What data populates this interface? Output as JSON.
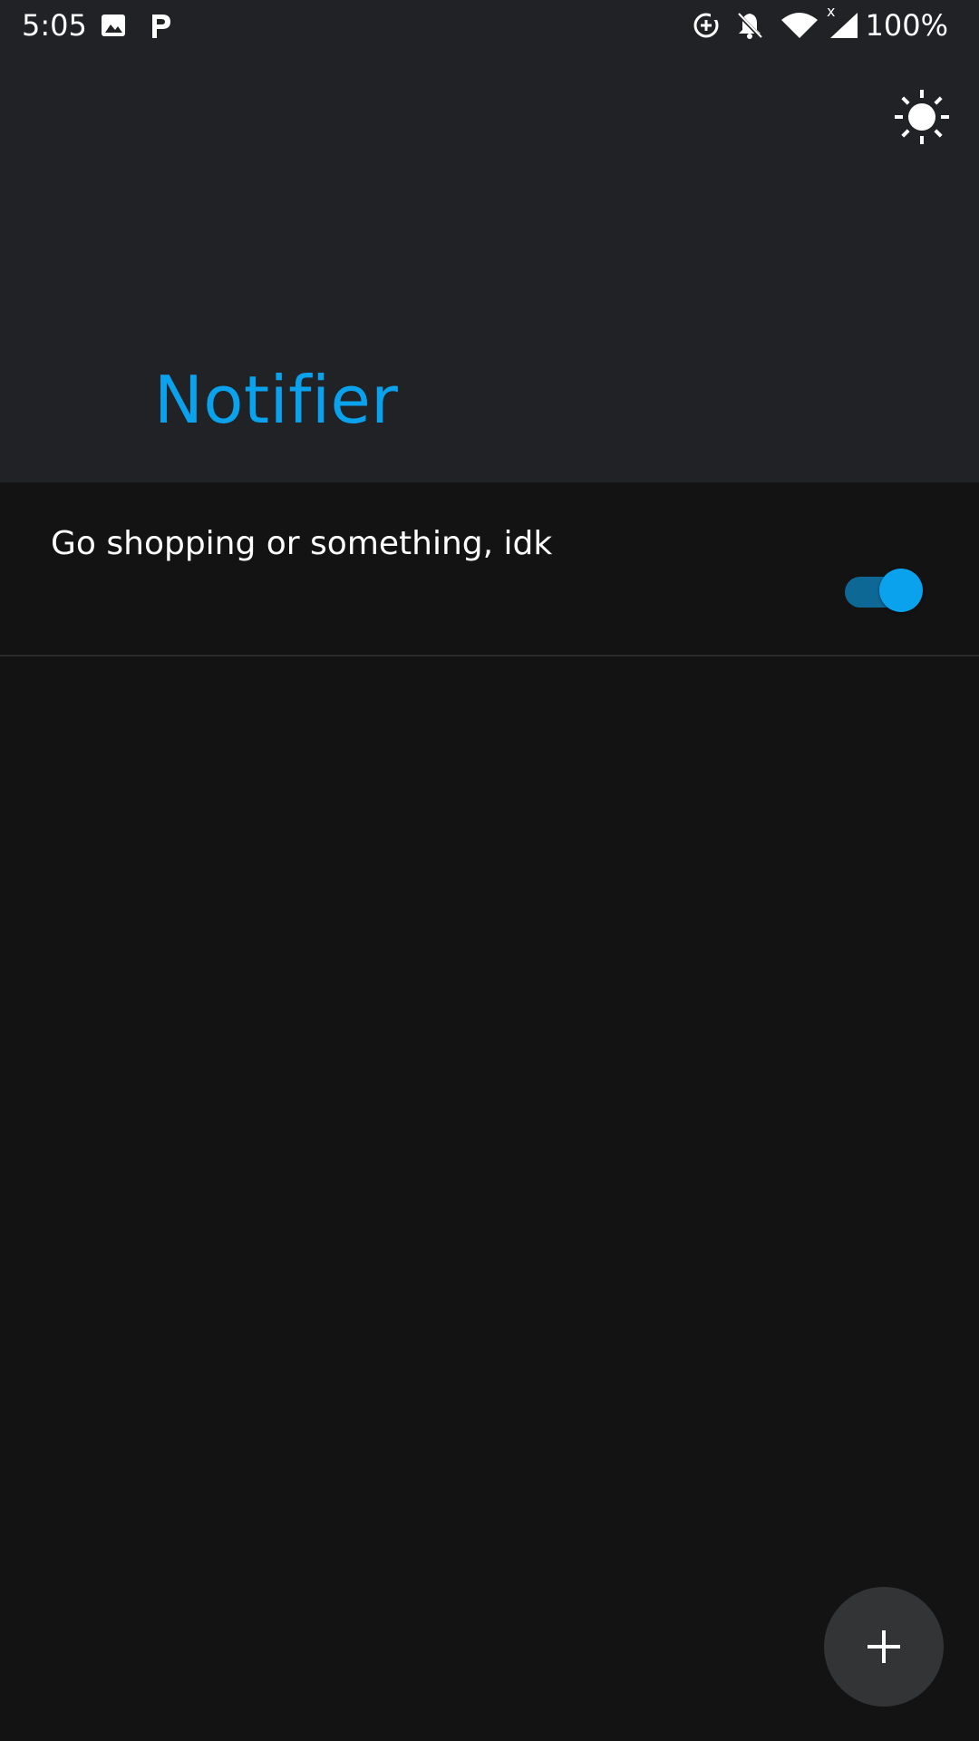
{
  "status_bar": {
    "time": "5:05",
    "battery": "100%",
    "network_label": "x",
    "icons": [
      "image-icon",
      "p-app-icon",
      "data-saver-icon",
      "notifications-off-icon",
      "wifi-icon",
      "cell-signal-icon"
    ]
  },
  "header": {
    "title": "Notifier",
    "theme_icon": "sun-icon"
  },
  "list": {
    "items": [
      {
        "text": "Go shopping or something, idk",
        "enabled": true
      }
    ]
  },
  "fab": {
    "icon": "plus-icon"
  },
  "colors": {
    "accent": "#0aa2ec",
    "header_bg": "#212226",
    "body_bg": "#131314",
    "fab_bg": "#333436"
  }
}
